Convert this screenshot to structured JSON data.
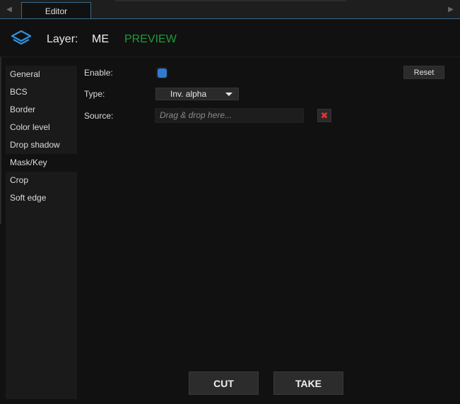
{
  "tabs": [
    {
      "label": "Editor"
    }
  ],
  "header": {
    "layer_label": "Layer:",
    "layer_name": "ME",
    "mode": "PREVIEW",
    "mode_color": "#1f9a3a",
    "icon": "layers-icon"
  },
  "sidebar": {
    "items": [
      {
        "label": "General"
      },
      {
        "label": "BCS"
      },
      {
        "label": "Border"
      },
      {
        "label": "Color level"
      },
      {
        "label": "Drop shadow"
      },
      {
        "label": "Mask/Key"
      },
      {
        "label": "Crop"
      },
      {
        "label": "Soft edge"
      }
    ],
    "active": "Mask/Key"
  },
  "form": {
    "enable_label": "Enable:",
    "enable_checked": true,
    "type_label": "Type:",
    "type_value": "Inv. alpha",
    "source_label": "Source:",
    "source_placeholder": "Drag & drop here...",
    "reset_label": "Reset",
    "accent_color": "#2e7bd4"
  },
  "actions": {
    "cut_label": "CUT",
    "take_label": "TAKE"
  }
}
